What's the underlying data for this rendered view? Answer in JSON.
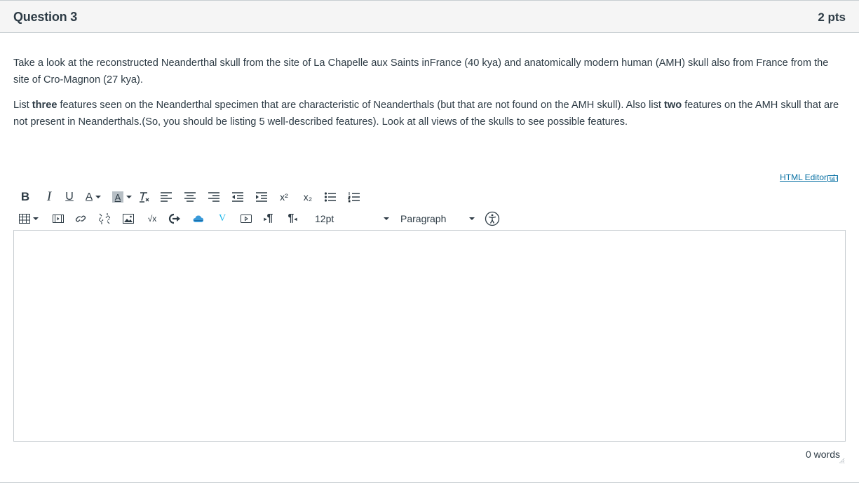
{
  "question": {
    "title": "Question 3",
    "points": "2 pts",
    "paragraph1": "Take a look at the reconstructed Neanderthal skull from the site of La Chapelle aux Saints inFrance (40 kya) and anatomically modern human (AMH) skull also from France from the site of Cro-Magnon (27 kya).",
    "paragraph2_part1": "List ",
    "paragraph2_bold1": "three",
    "paragraph2_part2": " features seen on the Neanderthal specimen that are characteristic of Neanderthals (but that are not found on the AMH skull). Also list ",
    "paragraph2_bold2": "two",
    "paragraph2_part3": " features on the AMH skull that are not present in Neanderthals.(So, you should be listing 5 well-described features). Look at all views of the skulls to see possible features."
  },
  "editor": {
    "html_editor_link": "HTML Editor",
    "toolbar_row1": [
      {
        "name": "bold-icon",
        "label": "B"
      },
      {
        "name": "italic-icon",
        "label": "I"
      },
      {
        "name": "underline-icon",
        "label": "U"
      },
      {
        "name": "text-color-icon",
        "label": "A"
      },
      {
        "name": "background-color-icon",
        "label": "A"
      },
      {
        "name": "clear-formatting-icon",
        "label": "Tx"
      },
      {
        "name": "align-left-icon"
      },
      {
        "name": "align-center-icon"
      },
      {
        "name": "align-right-icon"
      },
      {
        "name": "outdent-icon"
      },
      {
        "name": "indent-icon"
      },
      {
        "name": "superscript-icon",
        "label": "x²"
      },
      {
        "name": "subscript-icon",
        "label": "x₂"
      },
      {
        "name": "bullet-list-icon"
      },
      {
        "name": "numbered-list-icon"
      }
    ],
    "toolbar_row2": [
      {
        "name": "table-icon"
      },
      {
        "name": "media-icon"
      },
      {
        "name": "link-icon"
      },
      {
        "name": "unlink-icon"
      },
      {
        "name": "image-icon"
      },
      {
        "name": "equation-icon",
        "label": "√x"
      },
      {
        "name": "lti-tool-icon"
      },
      {
        "name": "cloud-icon"
      },
      {
        "name": "vimeo-icon",
        "label": "V"
      },
      {
        "name": "embed-icon"
      },
      {
        "name": "ltr-icon",
        "label": "¶"
      },
      {
        "name": "rtl-icon",
        "label": "¶"
      }
    ],
    "font_size": "12pt",
    "block_format": "Paragraph",
    "content": "",
    "word_count": "0 words"
  },
  "colors": {
    "text": "#2d3b45",
    "link": "#0770a3",
    "header_bg": "#f5f5f5",
    "border": "#c7cdd1"
  }
}
